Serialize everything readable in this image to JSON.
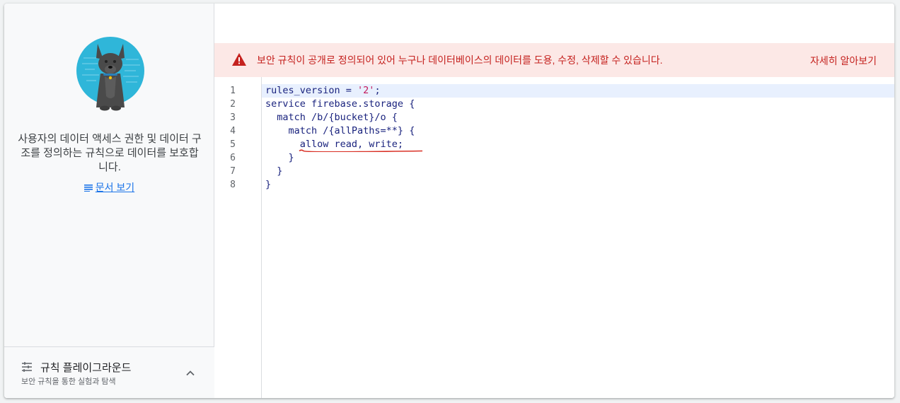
{
  "left_panel": {
    "description": "사용자의 데이터 액세스 권한 및 데이터 구조를 정의하는 규칙으로 데이터를 보호합니다.",
    "doc_link_label": "문서 보기",
    "doc_link_icon": "notes-icon",
    "playground": {
      "title": "규칙 플레이그라운드",
      "subtitle": "보안 규칙을 통한 실험과 탐색",
      "icon": "tune-icon",
      "chevron": "chevron-up-icon"
    }
  },
  "banner": {
    "icon": "warning-icon",
    "message": "보안 규칙이 공개로 정의되어 있어 누구나 데이터베이스의 데이터를 도용, 수정, 삭제할 수 있습니다.",
    "learn_more": "자세히 알아보기",
    "color": "#c5221f",
    "background": "#fce8e6"
  },
  "editor": {
    "line_numbers": [
      "1",
      "2",
      "3",
      "4",
      "5",
      "6",
      "7",
      "8"
    ],
    "lines": [
      {
        "pre": "rules_version = ",
        "str": "'2'",
        "post": ";"
      },
      {
        "pre": "service firebase.storage {",
        "str": "",
        "post": ""
      },
      {
        "pre": "  match /b/{bucket}/o {",
        "str": "",
        "post": ""
      },
      {
        "pre": "    match /{allPaths=**} {",
        "str": "",
        "post": ""
      },
      {
        "pre": "      allow read, write;",
        "str": "",
        "post": ""
      },
      {
        "pre": "    }",
        "str": "",
        "post": ""
      },
      {
        "pre": "  }",
        "str": "",
        "post": ""
      },
      {
        "pre": "}",
        "str": "",
        "post": ""
      }
    ],
    "active_line": 1,
    "error_line": 5
  },
  "colors": {
    "accent": "#1a73e8",
    "avatar_bg": "#2fb6d9",
    "code_text": "#1a237e",
    "code_string": "#c2185b"
  }
}
